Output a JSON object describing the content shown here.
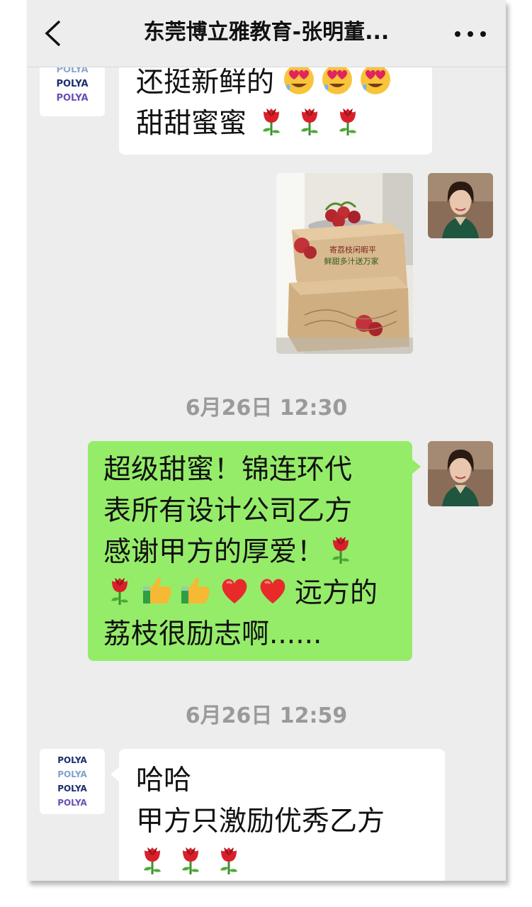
{
  "header": {
    "title": "东莞博立雅教育-张明董...",
    "back_icon": "chevron-left-icon",
    "more_icon": "ellipsis-icon"
  },
  "avatar_logo": {
    "word": "POLYA"
  },
  "messages": [
    {
      "sender": "other",
      "lines": [
        "还挺新鲜的",
        "甜甜蜜蜜"
      ]
    },
    {
      "sender": "self",
      "type": "image",
      "image_text": [
        "寄荔枝闲暇平",
        "鲜甜多汁送万家"
      ]
    },
    {
      "type": "timestamp",
      "text": "6月26日 12:30"
    },
    {
      "sender": "self",
      "lines": [
        "超级甜蜜！锦连环代",
        "表所有设计公司乙方",
        "感谢甲方的厚爱！",
        "",
        "远方的",
        "荔枝很励志啊......"
      ]
    },
    {
      "type": "timestamp",
      "text": "6月26日 12:59"
    },
    {
      "sender": "other",
      "lines": [
        "哈哈",
        "甲方只激励优秀乙方"
      ]
    }
  ],
  "colors": {
    "chat_bg": "#ededed",
    "self_bubble": "#95ec69",
    "other_bubble": "#ffffff",
    "timestamp": "#9a9a9a"
  }
}
